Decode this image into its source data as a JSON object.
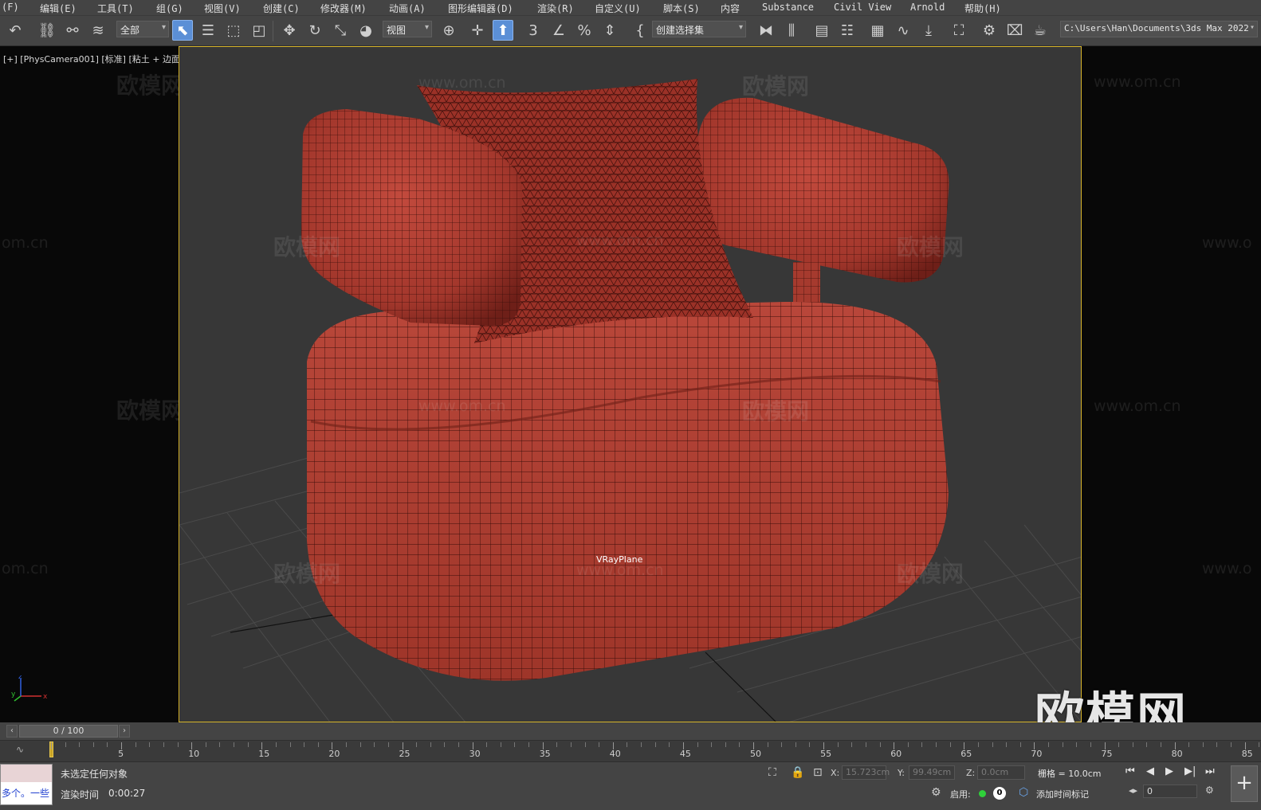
{
  "menu": [
    "(F)",
    "编辑(E)",
    "工具(T)",
    "组(G)",
    "视图(V)",
    "创建(C)",
    "修改器(M)",
    "动画(A)",
    "图形编辑器(D)",
    "渲染(R)",
    "自定义(U)",
    "脚本(S)",
    "内容",
    "Substance",
    "Civil View",
    "Arnold",
    "帮助(H)"
  ],
  "toolbar": {
    "filter_value": "全部",
    "refcoord_value": "视图",
    "selection_set": "创建选择集",
    "project_path": "C:\\Users\\Han\\Documents\\3ds Max 2022"
  },
  "viewport": {
    "label": "[+] [PhysCamera001] [标准] [粘土 + 边面]",
    "object_label": "VRayPlane",
    "watermark_brand": "欧模网",
    "watermark_url": "www.om.cn",
    "watermark_url_partial": "om.cn",
    "watermark_url_right": "www.o"
  },
  "timeline": {
    "current": "0 / 100",
    "ticks": [
      "5",
      "10",
      "15",
      "20",
      "25",
      "30",
      "35",
      "40",
      "45",
      "50",
      "55",
      "60",
      "65",
      "70",
      "75",
      "80",
      "85"
    ]
  },
  "status": {
    "listener_text": "多个。一些",
    "selection": "未选定任何对象",
    "render_time_label": "渲染时间",
    "render_time": "0:00:27",
    "x_label": "X:",
    "x_value": "15.723cm",
    "y_label": "Y:",
    "y_value": "99.49cm",
    "z_label": "Z:",
    "z_value": "0.0cm",
    "grid": "栅格 = 10.0cm",
    "enabled": "启用:",
    "badge": "0",
    "add_time_tag": "添加时间标记",
    "frame_value": "0"
  },
  "colors": {
    "chair": "#a8352b",
    "wire": "#3a0e0a",
    "viewport_border": "#d6b42a",
    "accent": "#5b8fd6"
  },
  "icons": [
    "undo-icon",
    "link-icon",
    "unlink-icon",
    "bind-spacewarp-icon",
    "select-icon",
    "select-by-name-icon",
    "rect-region-icon",
    "window-crossing-icon",
    "move-icon",
    "rotate-icon",
    "scale-icon",
    "place-icon",
    "pivot-icon",
    "mirror-icon",
    "align-icon",
    "layers-icon",
    "curve-editor-icon",
    "render-setup-icon",
    "render-icon"
  ]
}
